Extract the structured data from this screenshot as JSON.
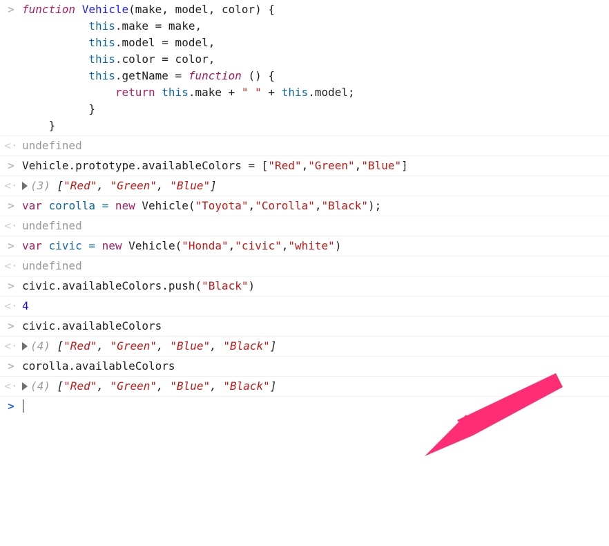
{
  "code": {
    "fn": "function",
    "vehicle": "Vehicle",
    "params_open": "(make, model, color) {",
    "line2a": "this",
    "line2b": ".make = make,",
    "line3b": ".model = model,",
    "line4b": ".color = color,",
    "line5b": ".getName = ",
    "line5c": "function",
    "line5d": " () {",
    "line6a": "return",
    "line6b": " this",
    "line6c": ".make + ",
    "line6d": "\" \"",
    "line6e": " + ",
    "line6f": "this",
    "line6g": ".model;",
    "close_brace": "}",
    "undefined": "undefined",
    "proto_assign_a": "Vehicle.prototype.availableColors = [",
    "q_red": "\"Red\"",
    "q_green": "\"Green\"",
    "q_blue": "\"Blue\"",
    "q_black": "\"Black\"",
    "comma": ",",
    "comma_sp": ", ",
    "rbracket": "]",
    "lbracket": "[",
    "count3": "(3) ",
    "count4": "(4) ",
    "var": "var",
    "new": "new",
    "corolla_decl_a": " corolla = ",
    "corolla_decl_b": " Vehicle(",
    "q_toyota": "\"Toyota\"",
    "q_corolla": "\"Corolla\"",
    "q_Black2": "\"Black\"",
    "decl_end": ");",
    "civic_decl_a": " civic = ",
    "civic_decl_b": " Vehicle(",
    "q_honda": "\"Honda\"",
    "q_civic": "\"civic\"",
    "q_white": "\"white\"",
    "rparen": ")",
    "push_call_a": "civic.availableColors.push(",
    "push_result": "4",
    "civic_colors": "civic.availableColors",
    "corolla_colors": "corolla.availableColors"
  },
  "icons": {
    "input": ">",
    "output": "<·",
    "prompt": ">"
  }
}
